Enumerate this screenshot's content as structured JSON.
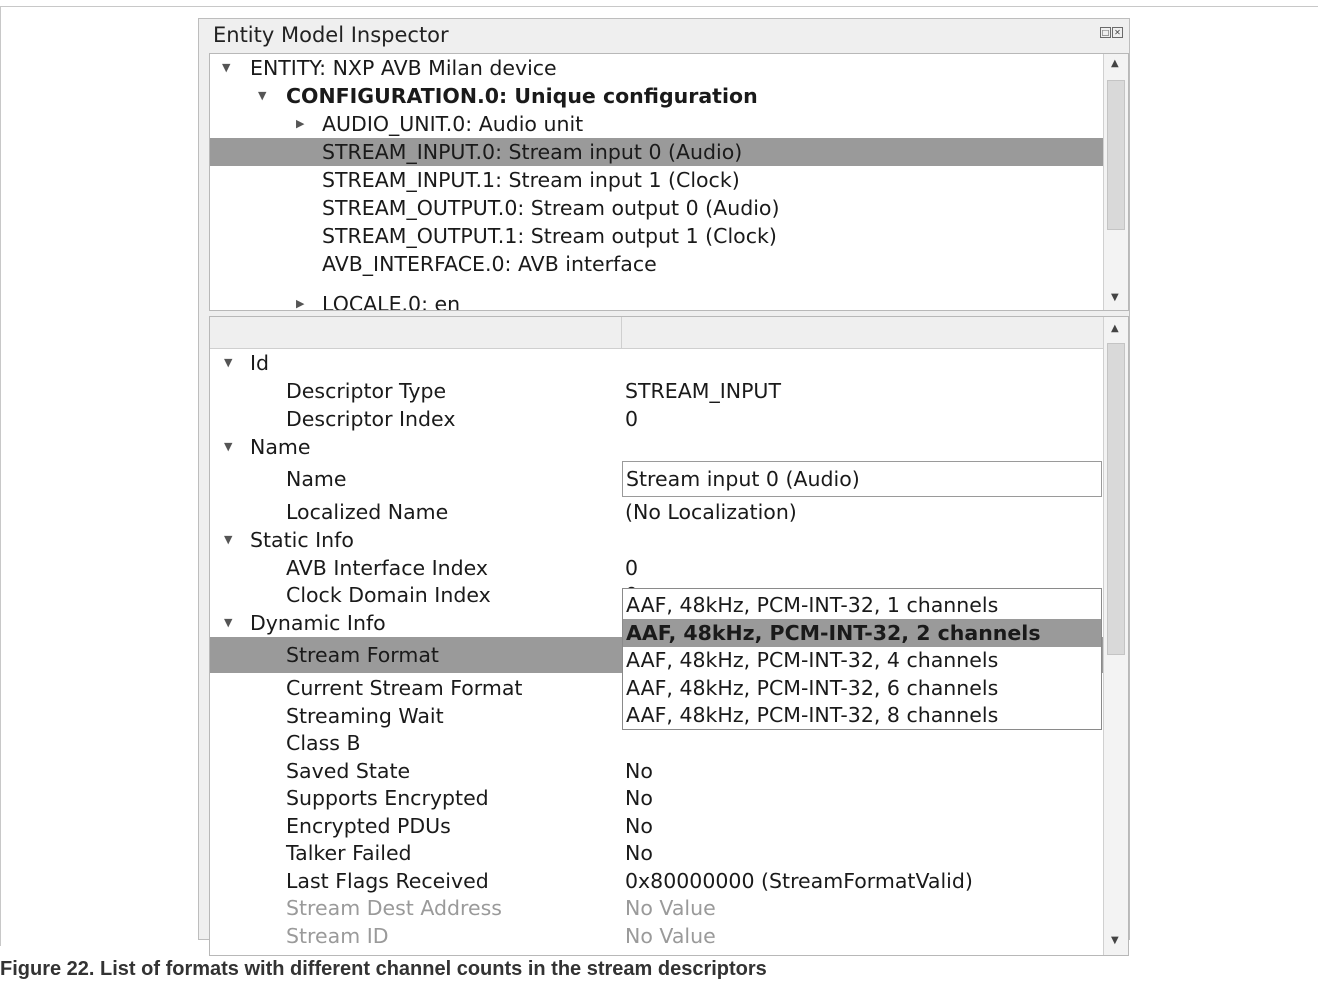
{
  "panel": {
    "title": "Entity Model Inspector",
    "float_icon": "restore-icon",
    "close_icon": "close-icon"
  },
  "tree": {
    "items": [
      {
        "label": "ENTITY: NXP AVB Milan device",
        "expander": "expanded"
      },
      {
        "label": "CONFIGURATION.0: Unique configuration",
        "expander": "expanded"
      },
      {
        "label": "AUDIO_UNIT.0: Audio unit",
        "expander": "collapsed"
      },
      {
        "label": "STREAM_INPUT.0: Stream input 0 (Audio)",
        "selected": true
      },
      {
        "label": "STREAM_INPUT.1: Stream input 1 (Clock)"
      },
      {
        "label": "STREAM_OUTPUT.0: Stream output 0 (Audio)"
      },
      {
        "label": "STREAM_OUTPUT.1: Stream output 1 (Clock)"
      },
      {
        "label": "AVB_INTERFACE.0: AVB interface"
      },
      {
        "label": "LOCALE.0: en",
        "expander": "collapsed"
      }
    ]
  },
  "properties": {
    "groups": {
      "id": "Id",
      "name": "Name",
      "static_info": "Static Info",
      "dynamic_info": "Dynamic Info"
    },
    "rows": {
      "descriptor_type": {
        "key": "Descriptor Type",
        "value": "STREAM_INPUT"
      },
      "descriptor_index": {
        "key": "Descriptor Index",
        "value": "0"
      },
      "name": {
        "key": "Name",
        "value": "Stream input 0 (Audio)"
      },
      "localized_name": {
        "key": "Localized Name",
        "value": "(No Localization)"
      },
      "avb_interface_index": {
        "key": "AVB Interface Index",
        "value": "0"
      },
      "clock_domain_index": {
        "key": "Clock Domain Index",
        "value": "0"
      },
      "stream_format": {
        "key": "Stream Format"
      },
      "current_stream_format": {
        "key": "Current Stream Format"
      },
      "streaming_wait": {
        "key": "Streaming Wait"
      },
      "class_b": {
        "key": "Class B"
      },
      "saved_state": {
        "key": "Saved State",
        "value": "No"
      },
      "supports_encrypted": {
        "key": "Supports Encrypted",
        "value": "No"
      },
      "encrypted_pdus": {
        "key": "Encrypted PDUs",
        "value": "No"
      },
      "talker_failed": {
        "key": "Talker Failed",
        "value": "No"
      },
      "last_flags_received": {
        "key": "Last Flags Received",
        "value": "0x80000000 (StreamFormatValid)"
      },
      "stream_dest_address": {
        "key": "Stream Dest Address",
        "value": "No Value"
      },
      "stream_id": {
        "key": "Stream ID",
        "value": "No Value"
      }
    }
  },
  "stream_format_dropdown": {
    "options": [
      "AAF, 48kHz, PCM-INT-32, 1 channels",
      "AAF, 48kHz, PCM-INT-32, 2 channels",
      "AAF, 48kHz, PCM-INT-32, 4 channels",
      "AAF, 48kHz, PCM-INT-32, 6 channels",
      "AAF, 48kHz, PCM-INT-32, 8 channels"
    ],
    "selected": "AAF, 48kHz, PCM-INT-32, 2 channels"
  },
  "caption": "Figure 22.  List of formats with different channel counts in the stream descriptors"
}
